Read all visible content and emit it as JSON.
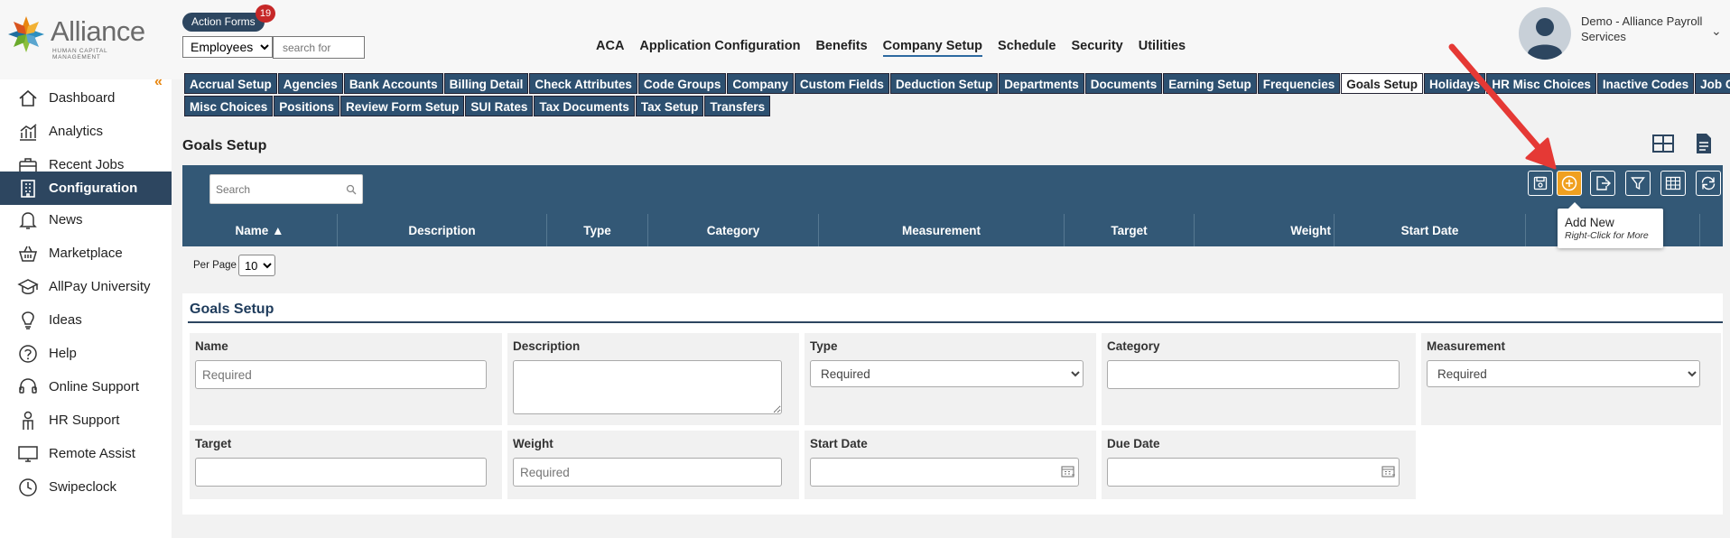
{
  "logo": {
    "brand": "Alliance",
    "sub": "HUMAN CAPITAL MANAGEMENT"
  },
  "header": {
    "action_forms_label": "Action Forms",
    "action_forms_count": "19",
    "employee_select": "Employees",
    "search_placeholder": "search for",
    "nav": [
      "ACA",
      "Application Configuration",
      "Benefits",
      "Company Setup",
      "Schedule",
      "Security",
      "Utilities"
    ],
    "nav_active": "Company Setup",
    "user_name": "Demo - Alliance Payroll Services"
  },
  "sidebar": {
    "items": [
      {
        "label": "Dashboard",
        "icon": "home-icon"
      },
      {
        "label": "Analytics",
        "icon": "analytics-icon"
      },
      {
        "label": "Recent Jobs",
        "icon": "briefcase-icon"
      },
      {
        "label": "Configuration",
        "icon": "building-icon",
        "active": true
      },
      {
        "label": "News",
        "icon": "bell-icon"
      },
      {
        "label": "Marketplace",
        "icon": "basket-icon"
      },
      {
        "label": "AllPay University",
        "icon": "graduation-cap-icon"
      },
      {
        "label": "Ideas",
        "icon": "lightbulb-icon"
      },
      {
        "label": "Help",
        "icon": "help-circle-icon"
      },
      {
        "label": "Online Support",
        "icon": "headset-icon"
      },
      {
        "label": "HR Support",
        "icon": "person-icon"
      },
      {
        "label": "Remote Assist",
        "icon": "monitor-icon"
      },
      {
        "label": "Swipeclock",
        "icon": "clock-icon"
      }
    ]
  },
  "tabs": {
    "row1": [
      "Accrual Setup",
      "Agencies",
      "Bank Accounts",
      "Billing Detail",
      "Check Attributes",
      "Code Groups",
      "Company",
      "Custom Fields",
      "Deduction Setup",
      "Departments",
      "Documents",
      "Earning Setup",
      "Frequencies",
      "Goals Setup",
      "Holidays",
      "HR Misc Choices",
      "Inactive Codes",
      "Job Codes"
    ],
    "row2": [
      "Misc Choices",
      "Positions",
      "Review Form Setup",
      "SUI Rates",
      "Tax Documents",
      "Tax Setup",
      "Transfers"
    ],
    "active": "Goals Setup"
  },
  "page": {
    "title": "Goals Setup"
  },
  "grid": {
    "search_placeholder": "Search",
    "columns": [
      "Name ▲",
      "Description",
      "Type",
      "Category",
      "Measurement",
      "Target",
      "Weight",
      "Start Date",
      ""
    ],
    "per_page_label": "Per Page",
    "per_page_value": "10"
  },
  "tooltip": {
    "title": "Add New",
    "sub": "Right-Click for More"
  },
  "form": {
    "title": "Goals Setup",
    "fields": {
      "name": {
        "label": "Name",
        "placeholder": "Required"
      },
      "description": {
        "label": "Description"
      },
      "type": {
        "label": "Type",
        "value": "Required"
      },
      "category": {
        "label": "Category"
      },
      "measurement": {
        "label": "Measurement",
        "value": "Required"
      },
      "target": {
        "label": "Target"
      },
      "weight": {
        "label": "Weight",
        "placeholder": "Required"
      },
      "start_date": {
        "label": "Start Date"
      },
      "due_date": {
        "label": "Due Date"
      }
    }
  },
  "colors": {
    "nav_dark": "#2d4660",
    "accent_orange": "#f0a020",
    "arrow_red": "#e53935"
  }
}
